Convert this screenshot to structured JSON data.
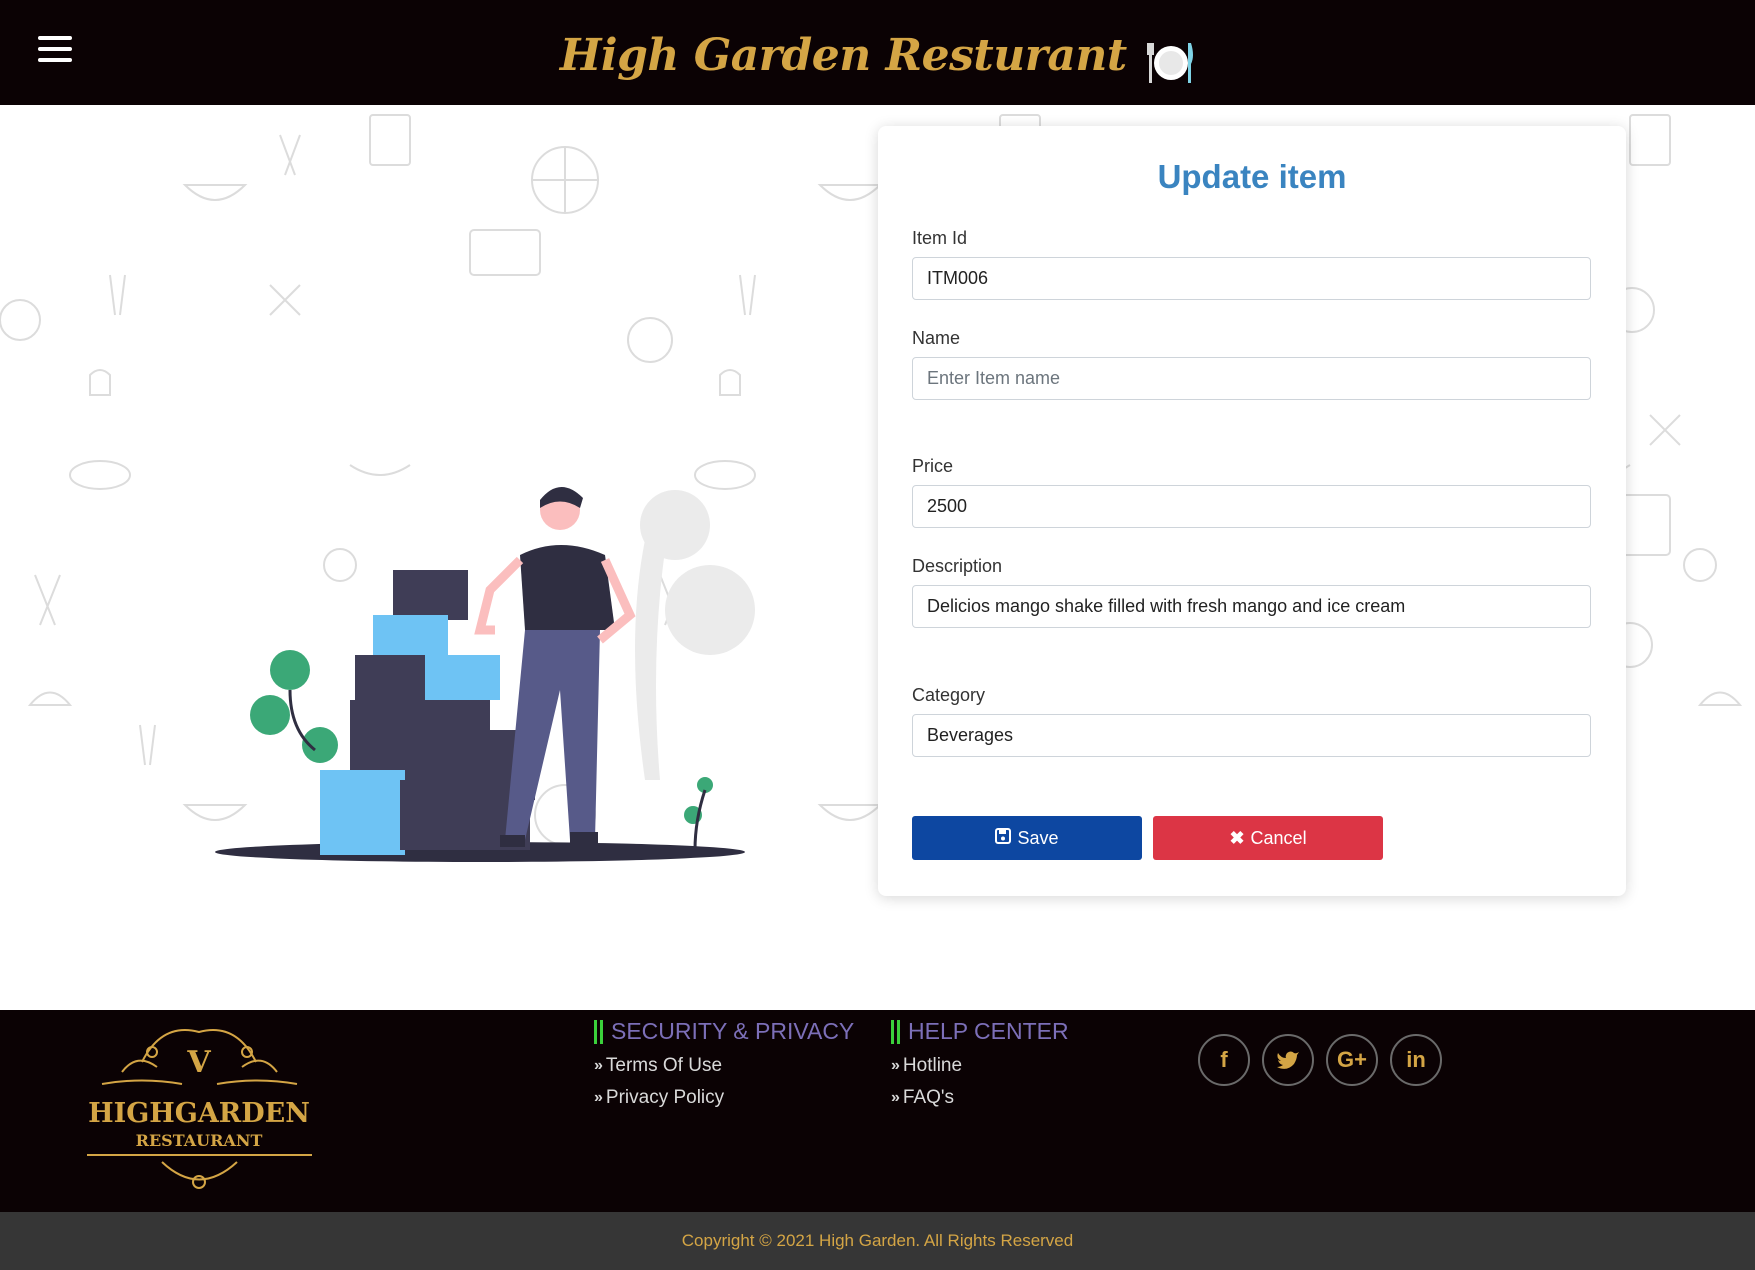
{
  "header": {
    "title": "High Garden Resturant",
    "menu_icon": "hamburger-icon",
    "brand_icon": "plate-cutlery-icon"
  },
  "form": {
    "title": "Update item",
    "item_id": {
      "label": "Item Id",
      "value": "ITM006",
      "placeholder": ""
    },
    "name": {
      "label": "Name",
      "value": "",
      "placeholder": "Enter Item name"
    },
    "price": {
      "label": "Price",
      "value": "2500",
      "placeholder": ""
    },
    "description": {
      "label": "Description",
      "value": "Delicios mango shake filled with fresh mango and ice cream",
      "placeholder": ""
    },
    "category": {
      "label": "Category",
      "value": "Beverages",
      "placeholder": ""
    },
    "save_label": "Save",
    "cancel_label": "Cancel"
  },
  "footer": {
    "logo_text_1": "HIGHGARDEN",
    "logo_text_2": "RESTAURANT",
    "logo_letter": "V",
    "security": {
      "heading": "SECURITY & PRIVACY",
      "links": [
        "Terms Of Use",
        "Privacy Policy"
      ]
    },
    "help": {
      "heading": "HELP CENTER",
      "links": [
        "Hotline",
        "FAQ's"
      ]
    },
    "socials": [
      {
        "icon": "facebook-icon",
        "glyph": "f"
      },
      {
        "icon": "twitter-icon",
        "glyph": "t"
      },
      {
        "icon": "google-plus-icon",
        "glyph": "G+"
      },
      {
        "icon": "linkedin-icon",
        "glyph": "in"
      }
    ],
    "copyright": "Copyright © 2021 High Garden. All Rights Reserved"
  },
  "colors": {
    "header_bg": "#0b0204",
    "brand_gold": "#d4a545",
    "title_blue": "#3a84c0",
    "save_blue": "#0d47a1",
    "cancel_red": "#dc3545",
    "footer_heading": "#7c6fb8",
    "accent_green": "#3bd13b"
  }
}
